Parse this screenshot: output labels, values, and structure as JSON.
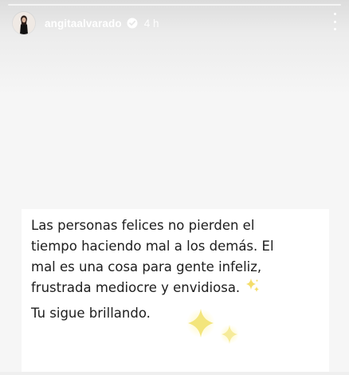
{
  "header": {
    "username": "angitaalvarado",
    "time": "4 h",
    "verified_icon": "verified-badge-icon",
    "more_icon": "more-options-icon"
  },
  "story": {
    "lines": [
      "Las personas felices no pierden el",
      "tiempo haciendo mal a los demás. El",
      "mal es una cosa para gente infeliz,",
      "frustrada mediocre y envidiosa."
    ],
    "closing": "Tu sigue brillando.",
    "emoji": "sparkles-icon",
    "sticker": "sparkles-sticker"
  },
  "colors": {
    "text": "#1d1d1d",
    "sparkle": "#f6e98a",
    "header_text": "#ffffff",
    "background": "#f6f6f6"
  }
}
